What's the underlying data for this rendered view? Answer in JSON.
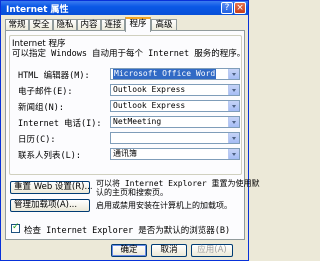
{
  "window": {
    "title": "Internet 属性"
  },
  "tabs": [
    {
      "label": "常规"
    },
    {
      "label": "安全"
    },
    {
      "label": "隐私"
    },
    {
      "label": "内容"
    },
    {
      "label": "连接"
    },
    {
      "label": "程序",
      "active": true
    },
    {
      "label": "高级"
    }
  ],
  "group": {
    "label": "Internet 程序",
    "description": "可以指定 Windows 自动用于每个 Internet 服务的程序。"
  },
  "programs": [
    {
      "label": "HTML 编辑器(M):",
      "value": "Microsoft Office Word",
      "selected": true
    },
    {
      "label": "电子邮件(E):",
      "value": "Outlook Express"
    },
    {
      "label": "新闻组(N):",
      "value": "Outlook Express"
    },
    {
      "label": "Internet 电话(I):",
      "value": "NetMeeting"
    },
    {
      "label": "日历(C):",
      "value": ""
    },
    {
      "label": "联系人列表(L):",
      "value": "通讯簿"
    }
  ],
  "actions": {
    "reset_web_label": "重置 Web 设置(R)...",
    "reset_web_desc_line1": "可以将 Internet Explorer 重置为使用默",
    "reset_web_desc_line2": "认的主页和搜索页。",
    "manage_addons_label": "管理加载项(A)...",
    "manage_addons_desc": "启用或禁用安装在计算机上的加载项。"
  },
  "default_check": {
    "label": "检查 Internet Explorer 是否为默认的浏览器(B)",
    "checked": true
  },
  "footer": {
    "ok": "确定",
    "cancel": "取消",
    "apply": "应用(A)"
  }
}
